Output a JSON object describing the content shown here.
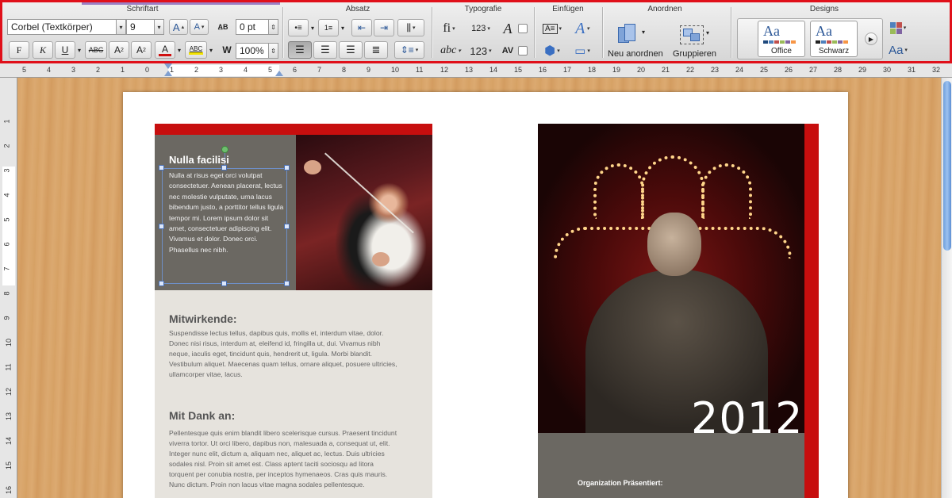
{
  "ribbon": {
    "groups": {
      "font": "Schriftart",
      "paragraph": "Absatz",
      "typography": "Typografie",
      "insert": "Einfügen",
      "arrange": "Anordnen",
      "designs": "Designs"
    },
    "font": {
      "family": "Corbel (Textkörper)",
      "size": "9",
      "grow": "A",
      "shrink": "A",
      "spacing_value": "0 pt",
      "scale_value": "100%",
      "bold": "F",
      "italic": "K",
      "underline": "U",
      "strike": "ABC",
      "superscript": "A",
      "subscript": "A",
      "color_a": "A",
      "highlight": "ABC",
      "kerning": "W"
    },
    "typography": {
      "ligatures": "fi",
      "number_forms": "123",
      "stylistic": "abc",
      "number_spacing": "123",
      "spacing": "AV"
    },
    "arrange": {
      "reorder_label": "Neu anordnen",
      "group_label": "Gruppieren"
    },
    "designs": {
      "themes": [
        {
          "aa": "Aa",
          "name": "Office"
        },
        {
          "aa": "Aa",
          "name": "Schwarz"
        }
      ],
      "fonts_aa": "Aa"
    }
  },
  "rulers": {
    "horizontal": [
      "5",
      "4",
      "3",
      "2",
      "1",
      "0",
      "1",
      "2",
      "3",
      "4",
      "5",
      "6",
      "7",
      "8",
      "9",
      "10",
      "11",
      "12",
      "13",
      "14",
      "15",
      "16",
      "17",
      "18",
      "19",
      "20",
      "21",
      "22",
      "23",
      "24",
      "25",
      "26",
      "27",
      "28",
      "29",
      "30",
      "31",
      "32"
    ],
    "vertical": [
      "1",
      "2",
      "3",
      "4",
      "5",
      "6",
      "7",
      "8",
      "9",
      "10",
      "11",
      "12",
      "13",
      "14",
      "15",
      "16"
    ]
  },
  "document": {
    "textbox_title": "Nulla facilisi",
    "textbox_body": "Nulla at risus eget orci volutpat consectetuer. Aenean placerat, lectus nec molestie vulputate, urna lacus bibendum justo, a porttitor tellus ligula tempor mi. Lorem ipsum dolor sit amet, consectetuer adipiscing elit. Vivamus et dolor. Donec orci. Phasellus nec nibh.",
    "section1_title": "Mitwirkende:",
    "section1_body": "Suspendisse lectus tellus, dapibus quis, mollis et, interdum vitae, dolor. Donec nisi risus, interdum at, eleifend id, fringilla ut, dui. Vivamus nibh neque, iaculis eget, tincidunt quis, hendrerit ut, ligula. Morbi blandit. Vestibulum aliquet. Maecenas quam tellus, ornare aliquet, posuere ultricies, ullamcorper vitae, lacus.",
    "section2_title": "Mit Dank an:",
    "section2_body": "Pellentesque quis enim blandit libero scelerisque cursus. Praesent tincidunt viverra tortor. Ut orci libero, dapibus non, malesuada a, consequat ut, elit. Integer nunc elit, dictum a, aliquam nec, aliquet ac, lectus. Duis ultricies sodales nisl. Proin sit amet est. Class aptent taciti sociosqu ad litora torquent per conubia nostra, per inceptos hymenaeos. Cras quis mauris. Nunc dictum. Proin non lacus vitae magna sodales pellentesque.",
    "year": "2012",
    "presenter": "Organization Präsentiert:"
  },
  "colors": {
    "accent_red": "#c70e0e",
    "panel_grey": "#6b6862",
    "panel_beige": "#e6e3dd",
    "highlight_outline": "#e0101a"
  }
}
